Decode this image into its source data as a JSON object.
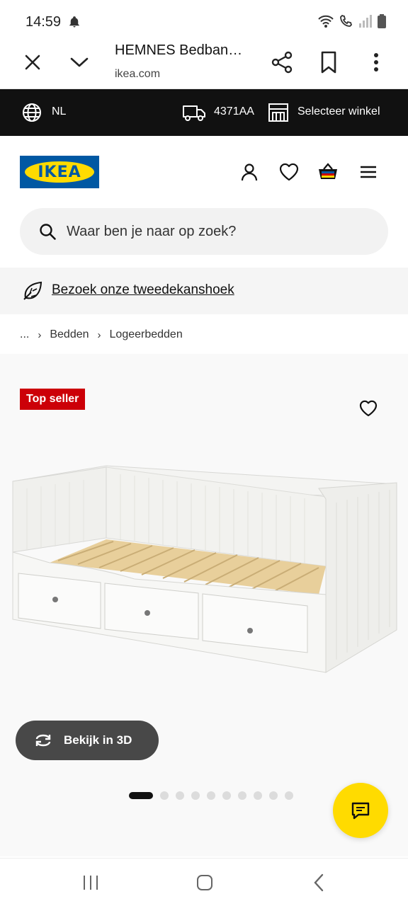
{
  "status_bar": {
    "time": "14:59"
  },
  "browser": {
    "title": "HEMNES Bedban…",
    "url": "ikea.com"
  },
  "topbar": {
    "language": "NL",
    "postcode": "4371AA",
    "store_label": "Selecteer winkel"
  },
  "header": {
    "logo_text": "IKEA"
  },
  "search": {
    "placeholder": "Waar ben je naar op zoek?"
  },
  "banner": {
    "link_text": "Bezoek onze tweedekanshoek"
  },
  "breadcrumb": {
    "items": [
      "...",
      "Bedden",
      "Logeerbedden"
    ]
  },
  "product": {
    "badge": "Top seller",
    "view_3d_label": "Bekijk in 3D",
    "carousel": {
      "total": 10,
      "active_index": 0
    }
  },
  "colors": {
    "ikea_blue": "#0058a3",
    "ikea_yellow": "#ffdb00",
    "badge_red": "#cc0008",
    "topbar_black": "#111111"
  },
  "icons": [
    "bell-icon",
    "close-icon",
    "chevron-down-icon",
    "share-icon",
    "bookmark-icon",
    "more-vert-icon",
    "globe-icon",
    "truck-icon",
    "store-icon",
    "user-icon",
    "heart-icon",
    "shopping-bag-icon",
    "menu-icon",
    "search-icon",
    "leaf-icon",
    "rotate-3d-icon",
    "chat-icon"
  ]
}
